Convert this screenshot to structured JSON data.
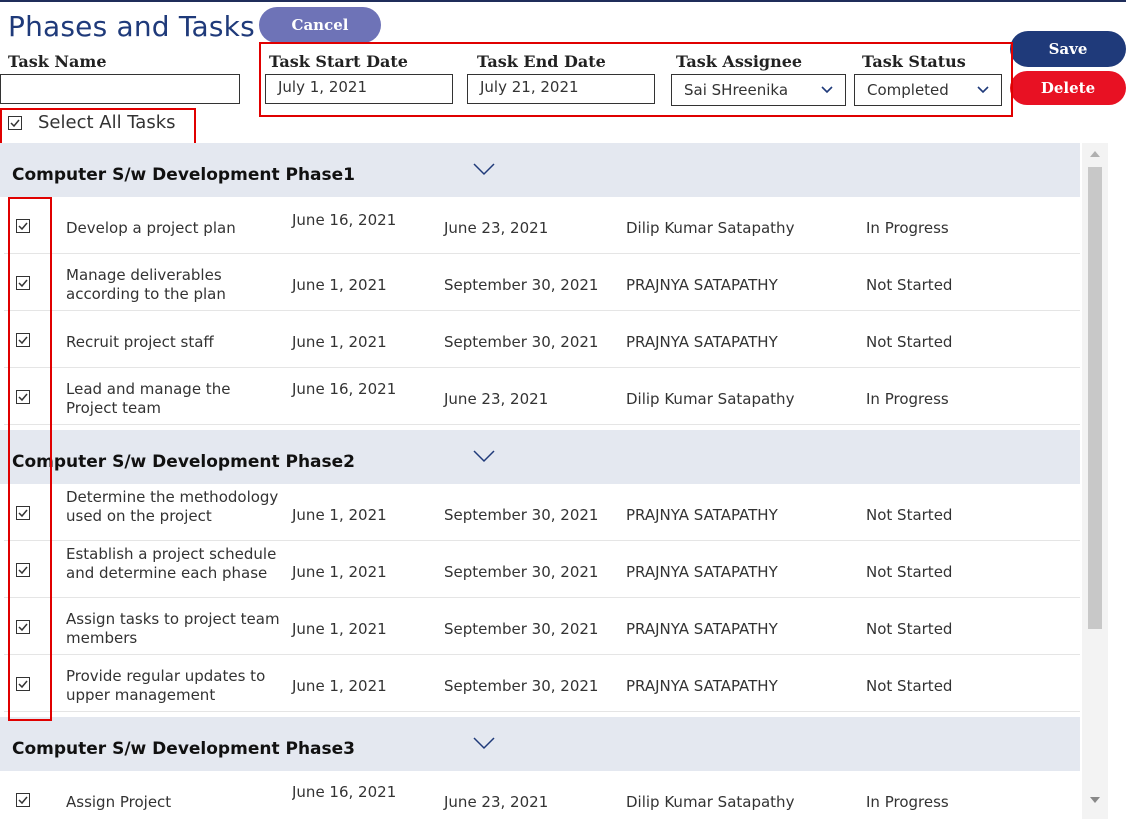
{
  "header": {
    "title": "Phases and Tasks",
    "cancel_label": "Cancel",
    "save_label": "Save",
    "delete_label": "Delete"
  },
  "form": {
    "task_name_label": "Task Name",
    "task_name_value": "",
    "start_label": "Task Start Date",
    "start_value": "July 1, 2021",
    "end_label": "Task End Date",
    "end_value": "July 21, 2021",
    "assignee_label": "Task Assignee",
    "assignee_value": "Sai SHreenika",
    "status_label": "Task Status",
    "status_value": "Completed",
    "select_all_label": "Select All Tasks"
  },
  "phases": [
    {
      "title": "Computer S/w Development Phase1",
      "tasks": [
        {
          "name": "Develop a project plan",
          "start": "June 16, 2021",
          "end": "June 23, 2021",
          "assignee": "Dilip Kumar Satapathy",
          "status": "In Progress"
        },
        {
          "name": "Manage deliverables according to the plan",
          "start": "June 1, 2021",
          "end": "September 30, 2021",
          "assignee": "PRAJNYA SATAPATHY",
          "status": "Not Started"
        },
        {
          "name": "Recruit project staff",
          "start": "June 1, 2021",
          "end": "September 30, 2021",
          "assignee": "PRAJNYA SATAPATHY",
          "status": "Not Started"
        },
        {
          "name": "Lead and manage the Project team",
          "start": "June 16, 2021",
          "end": "June 23, 2021",
          "assignee": "Dilip Kumar Satapathy",
          "status": "In Progress"
        }
      ]
    },
    {
      "title": "Computer S/w Development Phase2",
      "tasks": [
        {
          "name": "Determine the methodology used on the project",
          "start": "June 1, 2021",
          "end": "September 30, 2021",
          "assignee": "PRAJNYA SATAPATHY",
          "status": "Not Started"
        },
        {
          "name": "Establish a project schedule and determine each phase",
          "start": "June 1, 2021",
          "end": "September 30, 2021",
          "assignee": "PRAJNYA SATAPATHY",
          "status": "Not Started"
        },
        {
          "name": "Assign tasks to project team members",
          "start": "June 1, 2021",
          "end": "September 30, 2021",
          "assignee": "PRAJNYA SATAPATHY",
          "status": "Not Started"
        },
        {
          "name": "Provide regular updates to upper management",
          "start": "June 1, 2021",
          "end": "September 30, 2021",
          "assignee": "PRAJNYA SATAPATHY",
          "status": "Not Started"
        }
      ]
    },
    {
      "title": "Computer S/w Development Phase3",
      "tasks": [
        {
          "name": "Assign Project",
          "start": "June 16, 2021",
          "end": "June 23, 2021",
          "assignee": "Dilip Kumar Satapathy",
          "status": "In Progress"
        }
      ]
    }
  ],
  "colors": {
    "title": "#1f3a7a",
    "cancel": "#6e73b7",
    "save": "#1f3a7a",
    "delete": "#e81123",
    "highlight": "#e00000",
    "phase_bg": "#e4e8f0"
  }
}
